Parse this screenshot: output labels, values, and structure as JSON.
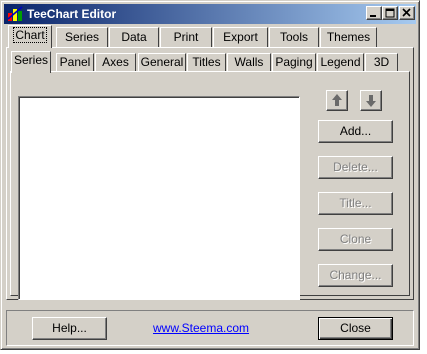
{
  "window": {
    "title": "TeeChart Editor"
  },
  "tabs": [
    "Chart",
    "Series",
    "Data",
    "Print",
    "Export",
    "Tools",
    "Themes"
  ],
  "subtabs": [
    "Series",
    "Panel",
    "Axes",
    "General",
    "Titles",
    "Walls",
    "Paging",
    "Legend",
    "3D"
  ],
  "buttons": {
    "add": "Add...",
    "delete": "Delete...",
    "title": "Title...",
    "clone": "Clone",
    "change": "Change..."
  },
  "footer": {
    "help": "Help...",
    "link": "www.Steema.com",
    "close": "Close"
  },
  "icons": [
    "app-icon",
    "minimize-icon",
    "maximize-icon",
    "close-icon",
    "arrow-up-icon",
    "arrow-down-icon"
  ]
}
